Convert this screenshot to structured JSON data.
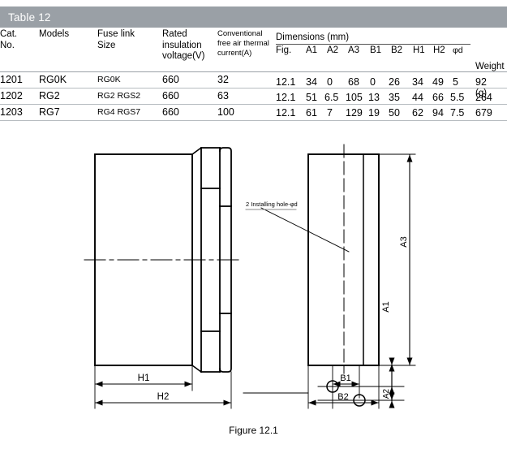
{
  "banner": {
    "title": "Table 12"
  },
  "table": {
    "headers": {
      "cat_no": [
        "Cat.",
        "No."
      ],
      "models": "Models",
      "fuse_link_size": [
        "Fuse link",
        "Size"
      ],
      "rated_insulation_voltage": [
        "Rated",
        "insulation",
        "voltage(V)"
      ],
      "conventional_current": [
        "Conventional",
        "free air thermal",
        "current(A)"
      ],
      "dimensions_group": "Dimensions (mm)",
      "dimension_cols": [
        "Fig.",
        "A1",
        "A2",
        "A3",
        "B1",
        "B2",
        "H1",
        "H2",
        "φd"
      ],
      "weight": "Weight",
      "weight_unit": "(g)"
    },
    "rows": [
      {
        "cat_no": "1201",
        "models": "RG0K",
        "fuse_link_size": "RG0K",
        "rated_insulation_voltage": "660",
        "conventional_current": "32",
        "fig": "12.1",
        "A1": "34",
        "A2": "0",
        "A3": "68",
        "B1": "0",
        "B2": "26",
        "H1": "34",
        "H2": "49",
        "phi_d": "5",
        "weight": "92"
      },
      {
        "cat_no": "1202",
        "models": "RG2",
        "fuse_link_size": "RG2 RGS2",
        "rated_insulation_voltage": "660",
        "conventional_current": "63",
        "fig": "12.1",
        "A1": "51",
        "A2": "6.5",
        "A3": "105",
        "B1": "13",
        "B2": "35",
        "H1": "44",
        "H2": "66",
        "phi_d": "5.5",
        "weight": "264"
      },
      {
        "cat_no": "1203",
        "models": "RG7",
        "fuse_link_size": "RG4 RGS7",
        "rated_insulation_voltage": "660",
        "conventional_current": "100",
        "fig": "12.1",
        "A1": "61",
        "A2": "7",
        "A3": "129",
        "B1": "19",
        "B2": "50",
        "H1": "62",
        "H2": "94",
        "phi_d": "7.5",
        "weight": "679"
      }
    ]
  },
  "figure": {
    "caption": "Figure 12.1",
    "side_view_labels": {
      "H1": "H1",
      "H2": "H2"
    },
    "front_view_labels": {
      "A1": "A1",
      "A2": "A2",
      "A3": "A3",
      "B1": "B1",
      "B2": "B2",
      "installing_hole_note": "2 Installing hole-φd"
    }
  },
  "colors": {
    "banner_bg": "#9aa0a6",
    "banner_text": "#ffffff",
    "rule": "#9aa0a6",
    "line": "#000000",
    "page_bg": "#ffffff"
  }
}
